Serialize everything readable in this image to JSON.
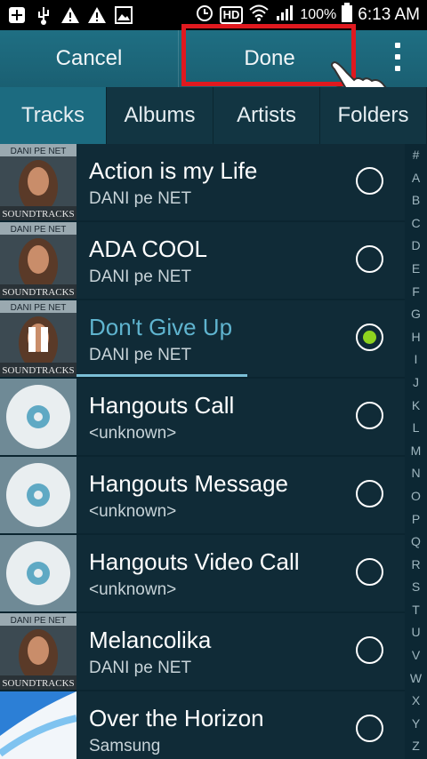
{
  "status_bar": {
    "icons_left": [
      "add-icon",
      "usb-icon",
      "warning-icon",
      "warning-icon",
      "image-icon"
    ],
    "hd": "HD",
    "battery_percent": "100%",
    "time": "6:13 AM"
  },
  "action_bar": {
    "cancel_label": "Cancel",
    "done_label": "Done",
    "highlight_color": "#e0191f"
  },
  "tabs": [
    {
      "label": "Tracks",
      "active": true
    },
    {
      "label": "Albums",
      "active": false
    },
    {
      "label": "Artists",
      "active": false
    },
    {
      "label": "Folders",
      "active": false
    }
  ],
  "tracks": [
    {
      "title": "Action is my Life",
      "artist": "DANI pe NET",
      "art": "album",
      "selected": false
    },
    {
      "title": "ADA COOL",
      "artist": "DANI pe NET",
      "art": "album",
      "selected": false
    },
    {
      "title": "Don't Give Up",
      "artist": "DANI pe NET",
      "art": "album-playing",
      "selected": true
    },
    {
      "title": "Hangouts Call",
      "artist": "<unknown>",
      "art": "disc",
      "selected": false
    },
    {
      "title": "Hangouts Message",
      "artist": "<unknown>",
      "art": "disc",
      "selected": false
    },
    {
      "title": "Hangouts Video Call",
      "artist": "<unknown>",
      "art": "disc",
      "selected": false
    },
    {
      "title": "Melancolika",
      "artist": "DANI pe NET",
      "art": "album",
      "selected": false
    },
    {
      "title": "Over the Horizon",
      "artist": "Samsung",
      "art": "horizon",
      "selected": false
    }
  ],
  "album_art_text": {
    "top": "DANI PE NET",
    "bottom": "SOUNDTRACKS"
  },
  "playback_progress": 0.52,
  "index_letters": [
    "#",
    "A",
    "B",
    "C",
    "D",
    "E",
    "F",
    "G",
    "H",
    "I",
    "J",
    "K",
    "L",
    "M",
    "N",
    "O",
    "P",
    "Q",
    "R",
    "S",
    "T",
    "U",
    "V",
    "W",
    "X",
    "Y",
    "Z"
  ]
}
